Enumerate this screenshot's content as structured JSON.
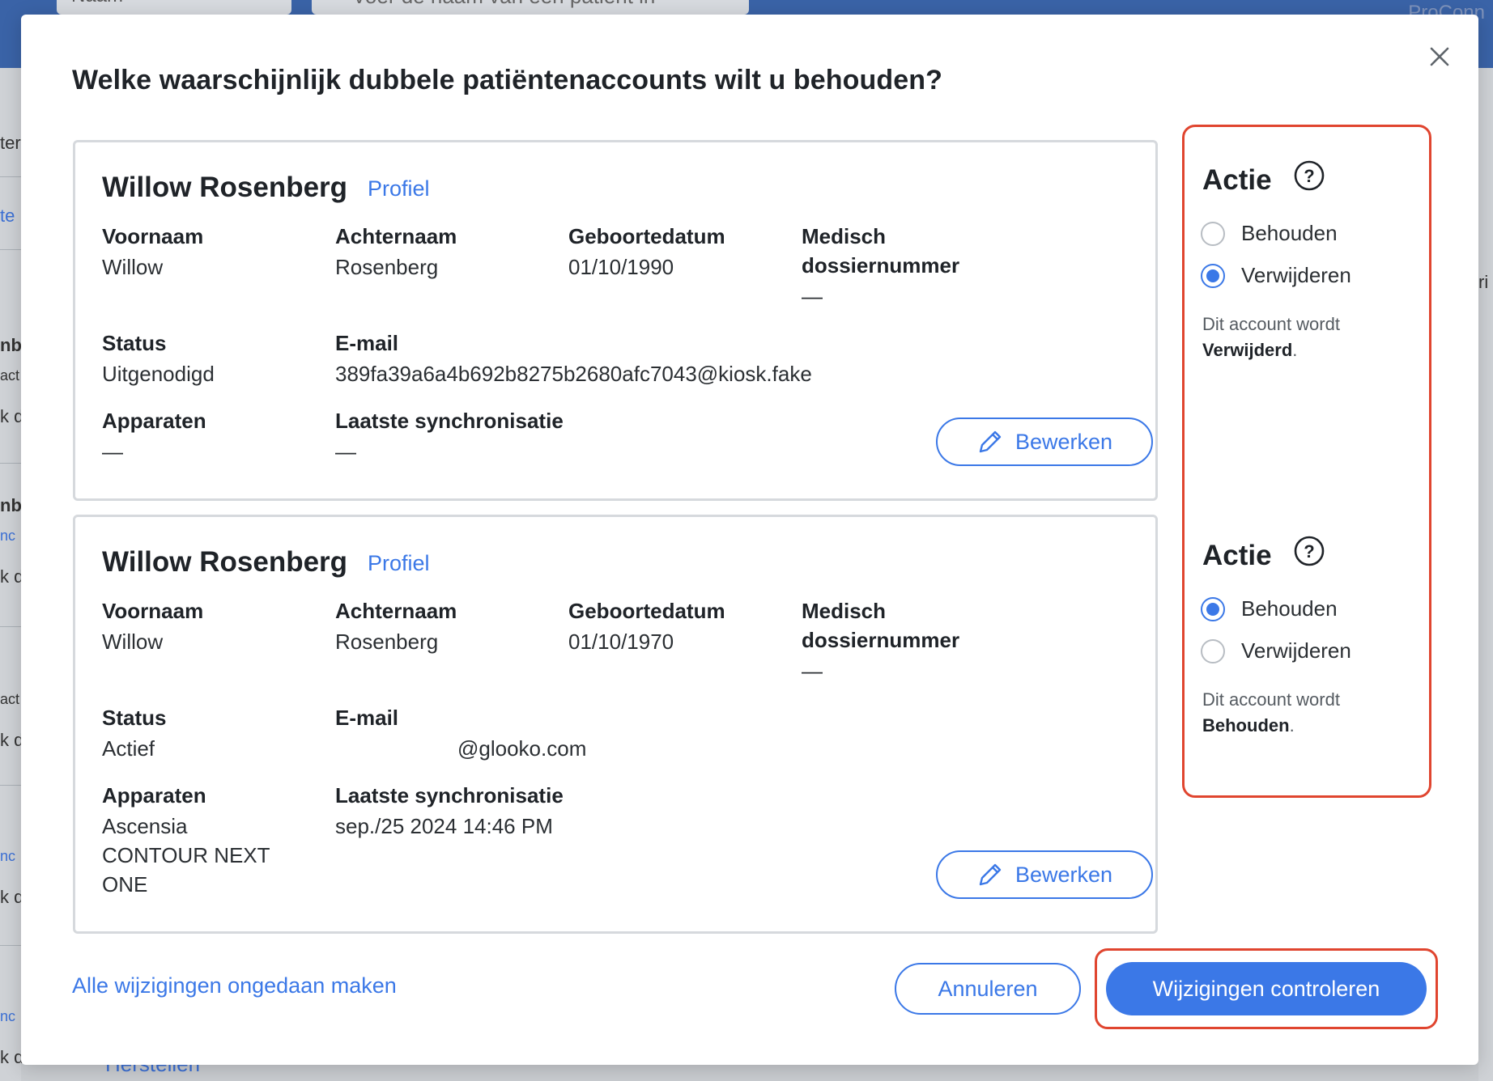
{
  "background": {
    "select_value": "Naam",
    "search_placeholder": "Voer de naam van een patiënt in",
    "brand": "ProConn",
    "left_fragments": [
      "ter",
      "te",
      "nb",
      "act",
      "k d",
      "nb",
      "nc",
      "k d",
      "act",
      "k d",
      "nc",
      "k d",
      "nc",
      "k d"
    ],
    "right_fragment": "ri",
    "bottom_text": "Herstellen"
  },
  "modal": {
    "title": "Welke waarschijnlijk dubbele patiëntenaccounts wilt u behouden?",
    "close_icon": "close-icon"
  },
  "labels": {
    "first_name": "Voornaam",
    "last_name": "Achternaam",
    "birth_date": "Geboortedatum",
    "mrn_line1": "Medisch",
    "mrn_line2": "dossiernummer",
    "status": "Status",
    "email": "E-mail",
    "devices": "Apparaten",
    "last_sync": "Laatste synchronisatie",
    "profile_link": "Profiel",
    "edit_button": "Bewerken"
  },
  "accounts": [
    {
      "name": "Willow Rosenberg",
      "first_name": "Willow",
      "last_name": "Rosenberg",
      "birth_date": "01/10/1990",
      "mrn": "—",
      "status": "Uitgenodigd",
      "email": "389fa39a6a4b692b8275b2680afc7043@kiosk.fake",
      "devices": [
        "—"
      ],
      "last_sync": "—",
      "action": "Verwijderen",
      "note_prefix": "Dit account wordt",
      "note_bold": "Verwijderd"
    },
    {
      "name": "Willow Rosenberg",
      "first_name": "Willow",
      "last_name": "Rosenberg",
      "birth_date": "01/10/1970",
      "mrn": "—",
      "status": "Actief",
      "email": "@glooko.com",
      "devices": [
        "Ascensia",
        "CONTOUR NEXT",
        "ONE"
      ],
      "last_sync": "sep./25 2024 14:46 PM",
      "action": "Behouden",
      "note_prefix": "Dit account wordt",
      "note_bold": "Behouden"
    }
  ],
  "action_panel": {
    "title": "Actie",
    "help_icon": "help-icon",
    "options": [
      "Behouden",
      "Verwijderen"
    ]
  },
  "footer": {
    "undo_all": "Alle wijzigingen ongedaan maken",
    "cancel": "Annuleren",
    "review": "Wijzigingen controleren"
  },
  "colors": {
    "accent": "#3b78e7",
    "highlight": "#e0452f",
    "topbar": "#3a63a7"
  }
}
